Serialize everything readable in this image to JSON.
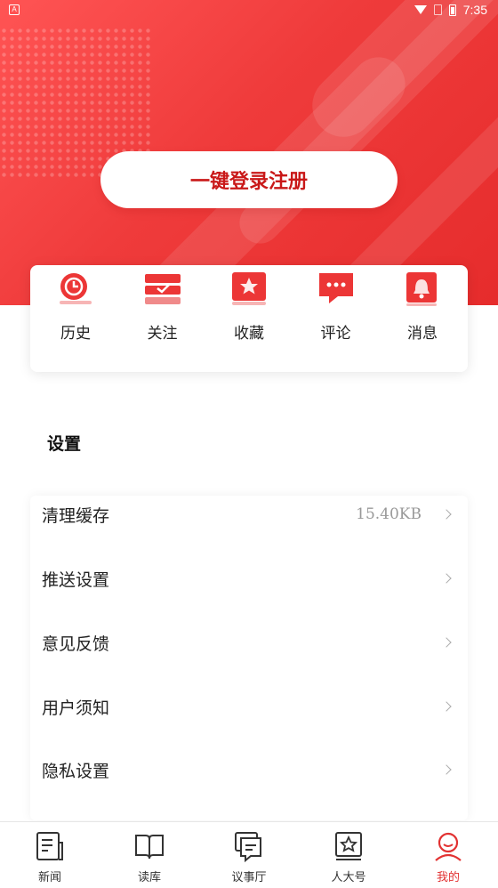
{
  "status_bar": {
    "notification_icon": "A",
    "time": "7:35"
  },
  "header": {
    "login_label": "一键登录注册"
  },
  "quick_actions": [
    {
      "label": "历史",
      "icon": "history-icon"
    },
    {
      "label": "关注",
      "icon": "follow-icon"
    },
    {
      "label": "收藏",
      "icon": "favorite-icon"
    },
    {
      "label": "评论",
      "icon": "comment-icon"
    },
    {
      "label": "消息",
      "icon": "message-bell-icon"
    }
  ],
  "settings": {
    "title": "设置",
    "items": [
      {
        "label": "清理缓存",
        "value": "15.40KB"
      },
      {
        "label": "推送设置"
      },
      {
        "label": "意见反馈"
      },
      {
        "label": "用户须知"
      },
      {
        "label": "隐私设置"
      }
    ]
  },
  "tabbar": {
    "items": [
      {
        "label": "新闻",
        "icon": "news-icon"
      },
      {
        "label": "读库",
        "icon": "book-icon"
      },
      {
        "label": "议事厅",
        "icon": "discussion-icon"
      },
      {
        "label": "人大号",
        "icon": "star-badge-icon"
      },
      {
        "label": "我的",
        "icon": "profile-icon",
        "active": true
      }
    ]
  },
  "colors": {
    "brand_red": "#e62c2c",
    "active_tab": "#e23232",
    "icon_red": "#ec3636"
  }
}
